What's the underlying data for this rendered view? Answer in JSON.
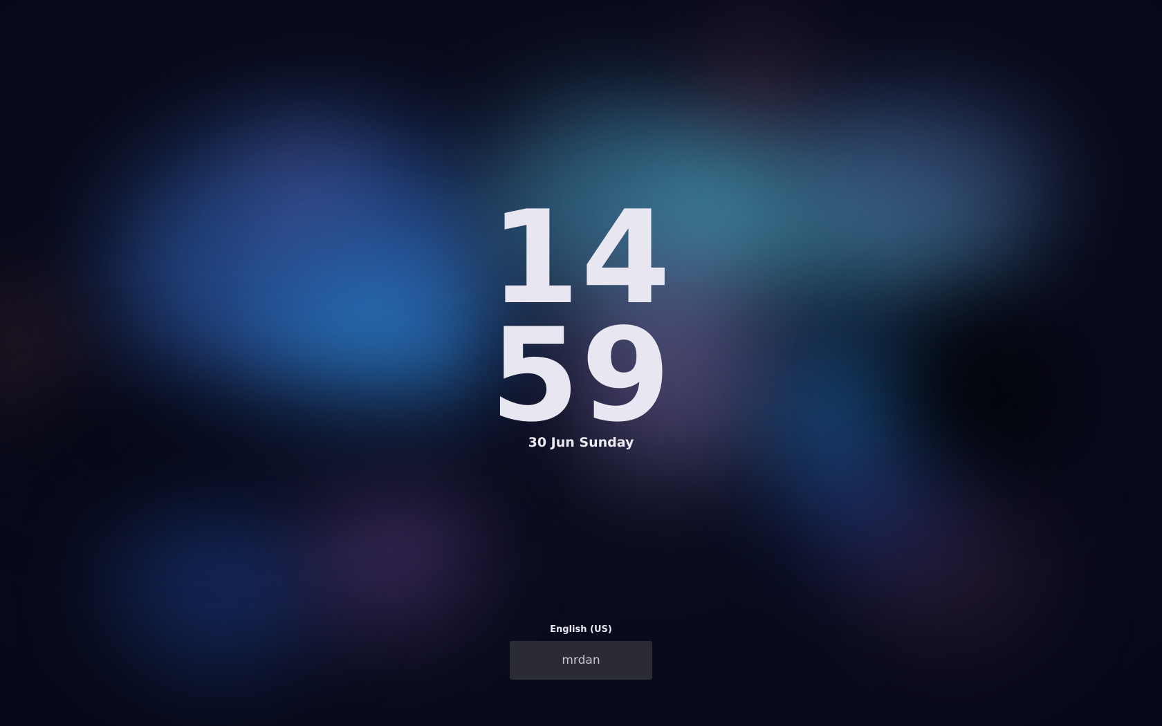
{
  "lockscreen": {
    "time": {
      "hours": "14",
      "minutes": "59"
    },
    "date": "30 Jun Sunday",
    "keyboard_layout": "English (US)",
    "username_field": {
      "value": "mrdan"
    }
  },
  "colors": {
    "text": "#e8e6f0",
    "field_background": "#2b2b33",
    "field_text": "#c9c8d2",
    "wallpaper_base": "#0a0c1e"
  }
}
